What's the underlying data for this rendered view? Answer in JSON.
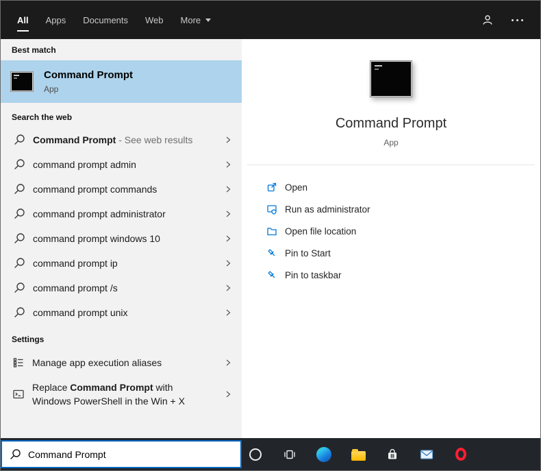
{
  "colors": {
    "accent": "#0078d7",
    "selection_bg": "#aed3ec",
    "header_bg": "#1b1b1c",
    "left_panel_bg": "#f2f2f2",
    "taskbar_bg": "#22262b",
    "search_border": "#0067c0"
  },
  "header": {
    "tabs": [
      {
        "label": "All",
        "selected": true
      },
      {
        "label": "Apps",
        "selected": false
      },
      {
        "label": "Documents",
        "selected": false
      },
      {
        "label": "Web",
        "selected": false
      },
      {
        "label": "More",
        "selected": false,
        "has_dropdown": true
      }
    ],
    "icons": [
      "account-icon",
      "more-options-icon"
    ]
  },
  "left_panel": {
    "best_match": {
      "section_label": "Best match",
      "item": {
        "title": "Command Prompt",
        "subtitle": "App",
        "icon": "command-prompt-icon"
      }
    },
    "search_the_web": {
      "section_label": "Search the web",
      "first_item": {
        "bold": "Command Prompt",
        "suffix": " - See web results"
      },
      "items": [
        "command prompt admin",
        "command prompt commands",
        "command prompt administrator",
        "command prompt windows 10",
        "command prompt ip",
        "command prompt /s",
        "command prompt unix"
      ]
    },
    "settings": {
      "section_label": "Settings",
      "item1": {
        "text": "Manage app execution aliases",
        "icon": "app-aliases-icon"
      },
      "item2": {
        "prefix": "Replace ",
        "bold": "Command Prompt",
        "suffix": " with Windows PowerShell in the Win + X",
        "icon": "console-window-icon"
      }
    }
  },
  "preview": {
    "title": "Command Prompt",
    "subtitle": "App",
    "icon": "command-prompt-icon-large",
    "actions": [
      {
        "label": "Open",
        "icon": "open-icon"
      },
      {
        "label": "Run as administrator",
        "icon": "run-admin-icon"
      },
      {
        "label": "Open file location",
        "icon": "file-location-icon"
      },
      {
        "label": "Pin to Start",
        "icon": "pin-icon"
      },
      {
        "label": "Pin to taskbar",
        "icon": "pin-icon"
      }
    ]
  },
  "search_box": {
    "value": "Command Prompt"
  },
  "taskbar": {
    "icons": [
      "cortana-icon",
      "task-view-icon",
      "edge-icon",
      "file-explorer-icon",
      "store-icon",
      "mail-icon",
      "opera-icon"
    ]
  }
}
